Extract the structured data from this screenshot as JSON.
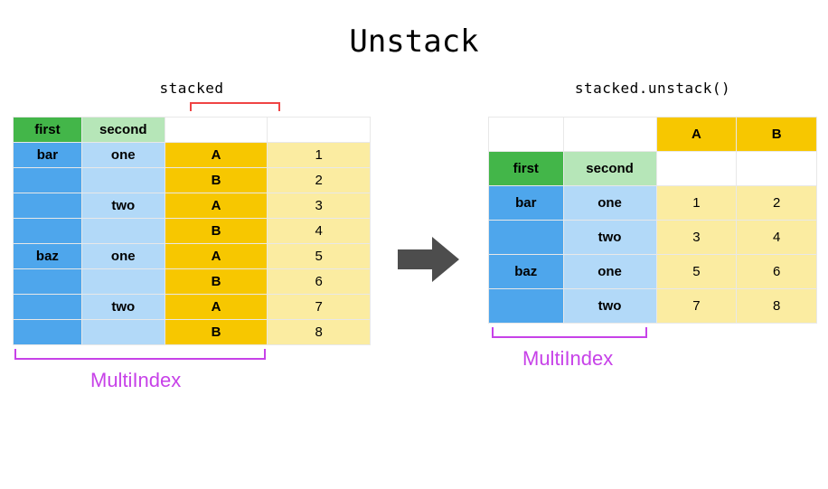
{
  "title": "Unstack",
  "left": {
    "label": "stacked",
    "headers": {
      "first": "first",
      "second": "second"
    },
    "rows": [
      {
        "first": "bar",
        "second": "one",
        "col": "A",
        "val": "1"
      },
      {
        "first": "",
        "second": "",
        "col": "B",
        "val": "2"
      },
      {
        "first": "",
        "second": "two",
        "col": "A",
        "val": "3"
      },
      {
        "first": "",
        "second": "",
        "col": "B",
        "val": "4"
      },
      {
        "first": "baz",
        "second": "one",
        "col": "A",
        "val": "5"
      },
      {
        "first": "",
        "second": "",
        "col": "B",
        "val": "6"
      },
      {
        "first": "",
        "second": "two",
        "col": "A",
        "val": "7"
      },
      {
        "first": "",
        "second": "",
        "col": "B",
        "val": "8"
      }
    ],
    "bottom_caption": "MultiIndex"
  },
  "right": {
    "label": "stacked.unstack()",
    "col_headers": {
      "a": "A",
      "b": "B"
    },
    "headers": {
      "first": "first",
      "second": "second"
    },
    "rows": [
      {
        "first": "bar",
        "second": "one",
        "a": "1",
        "b": "2"
      },
      {
        "first": "",
        "second": "two",
        "a": "3",
        "b": "4"
      },
      {
        "first": "baz",
        "second": "one",
        "a": "5",
        "b": "6"
      },
      {
        "first": "",
        "second": "two",
        "a": "7",
        "b": "8"
      }
    ],
    "bottom_caption": "MultiIndex"
  },
  "chart_data": {
    "type": "table",
    "title": "Unstack",
    "stacked": {
      "index_names": [
        "first",
        "second",
        ""
      ],
      "records": [
        [
          "bar",
          "one",
          "A",
          1
        ],
        [
          "bar",
          "one",
          "B",
          2
        ],
        [
          "bar",
          "two",
          "A",
          3
        ],
        [
          "bar",
          "two",
          "B",
          4
        ],
        [
          "baz",
          "one",
          "A",
          5
        ],
        [
          "baz",
          "one",
          "B",
          6
        ],
        [
          "baz",
          "two",
          "A",
          7
        ],
        [
          "baz",
          "two",
          "B",
          8
        ]
      ]
    },
    "unstacked": {
      "index_names": [
        "first",
        "second"
      ],
      "columns": [
        "A",
        "B"
      ],
      "records": [
        [
          "bar",
          "one",
          1,
          2
        ],
        [
          "bar",
          "two",
          3,
          4
        ],
        [
          "baz",
          "one",
          5,
          6
        ],
        [
          "baz",
          "two",
          7,
          8
        ]
      ]
    }
  }
}
